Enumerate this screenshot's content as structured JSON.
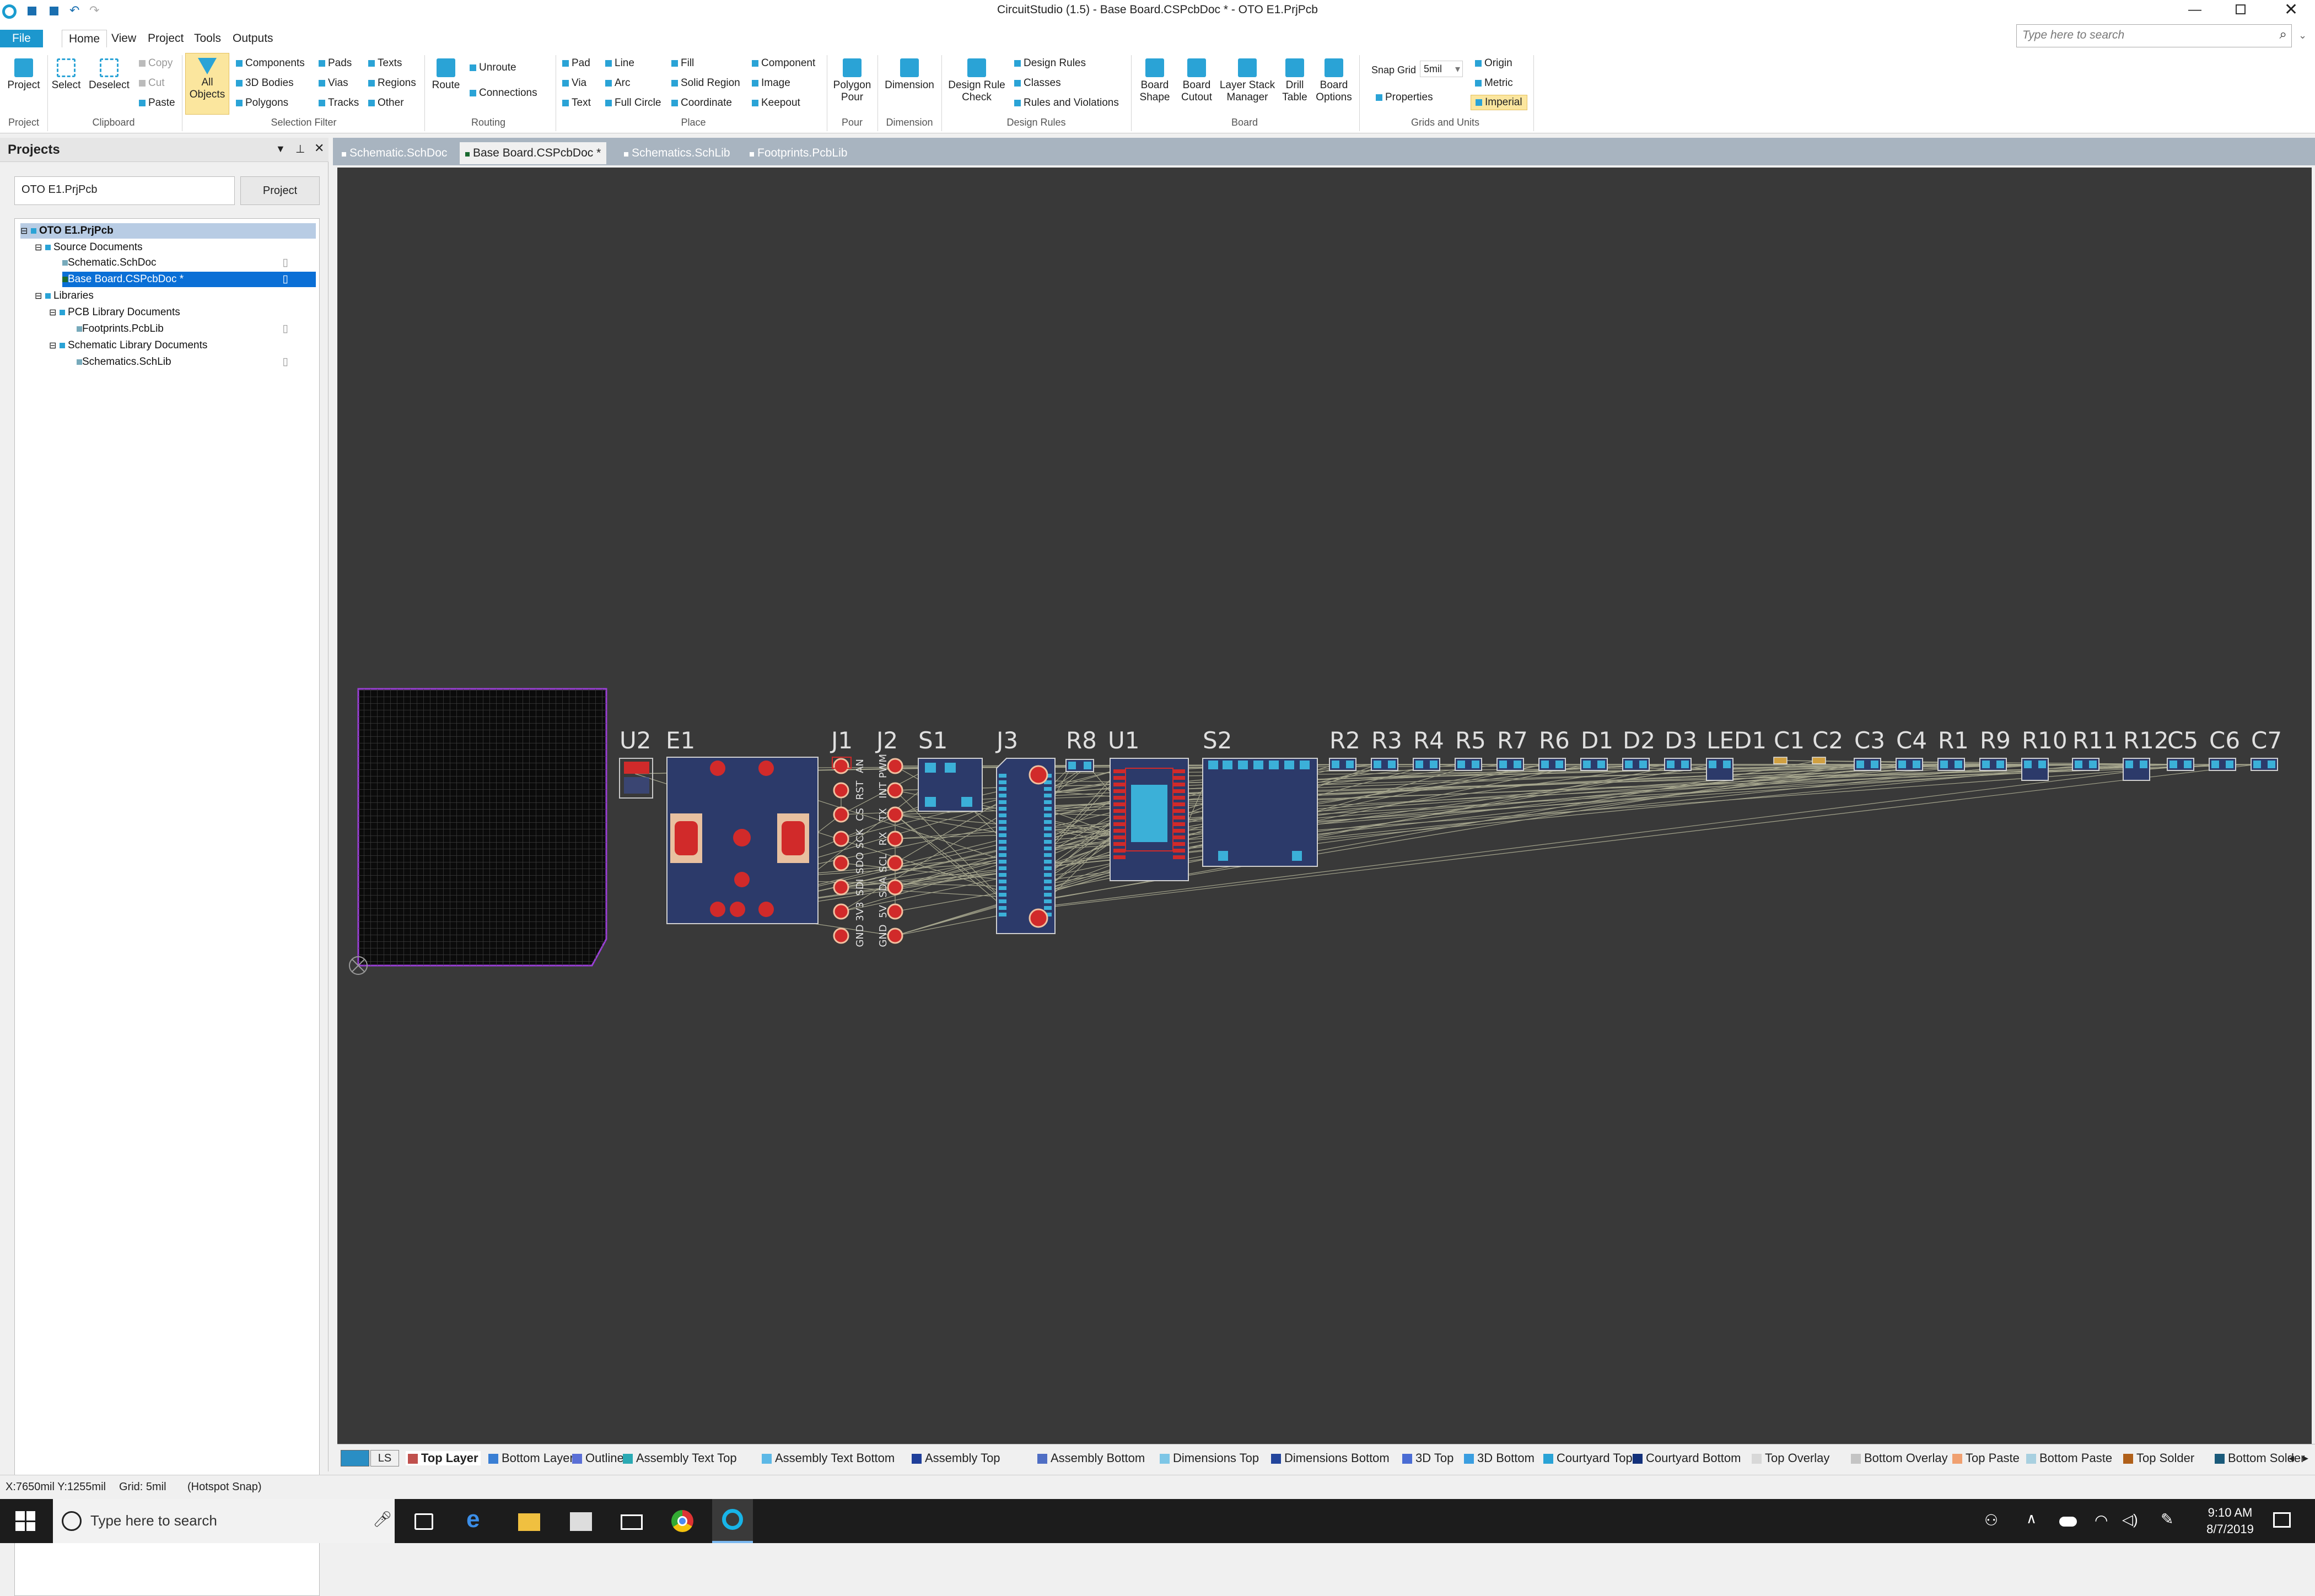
{
  "window": {
    "title": "CircuitStudio (1.5) - Base Board.CSPcbDoc * - OTO E1.PrjPcb",
    "search_placeholder": "Type here to search"
  },
  "menu": {
    "file": "File",
    "items": [
      "Home",
      "View",
      "Project",
      "Tools",
      "Outputs"
    ]
  },
  "ribbon": {
    "project": {
      "btn": "Project",
      "label": "Project"
    },
    "clipboard": {
      "select": "Select",
      "deselect": "Deselect",
      "copy": "Copy",
      "cut": "Cut",
      "paste": "Paste",
      "label": "Clipboard"
    },
    "selection": {
      "all_objects": [
        "All",
        "Objects"
      ],
      "components": "Components",
      "bodies": "3D Bodies",
      "polygons": "Polygons",
      "pads": "Pads",
      "vias": "Vias",
      "tracks": "Tracks",
      "texts": "Texts",
      "regions": "Regions",
      "other": "Other",
      "label": "Selection Filter"
    },
    "routing": {
      "route": "Route",
      "unroute": "Unroute",
      "connections": "Connections",
      "label": "Routing"
    },
    "place": {
      "pad": "Pad",
      "via": "Via",
      "text": "Text",
      "line": "Line",
      "arc": "Arc",
      "full_circle": "Full Circle",
      "fill": "Fill",
      "solid_region": "Solid Region",
      "coordinate": "Coordinate",
      "component": "Component",
      "image": "Image",
      "keepout": "Keepout",
      "label": "Place"
    },
    "pour": {
      "polygon": [
        "Polygon",
        "Pour"
      ],
      "label": "Pour"
    },
    "dimension": {
      "btn": "Dimension",
      "label": "Dimension"
    },
    "design_rules": {
      "check": [
        "Design Rule",
        "Check"
      ],
      "rules": "Design Rules",
      "classes": "Classes",
      "violations": "Rules and Violations",
      "label": "Design Rules"
    },
    "board": {
      "shape": [
        "Board",
        "Shape"
      ],
      "cutout": [
        "Board",
        "Cutout"
      ],
      "stack": [
        "Layer Stack",
        "Manager"
      ],
      "drill": [
        "Drill",
        "Table"
      ],
      "options": [
        "Board",
        "Options"
      ],
      "label": "Board"
    },
    "grids": {
      "snap_label": "Snap Grid",
      "snap_value": "5mil",
      "properties": "Properties",
      "origin": "Origin",
      "metric": "Metric",
      "imperial": "Imperial",
      "label": "Grids and Units"
    }
  },
  "panel": {
    "title": "Projects",
    "project_field": "OTO E1.PrjPcb",
    "project_btn": "Project",
    "tree": [
      "OTO E1.PrjPcb",
      "Source Documents",
      "Schematic.SchDoc",
      "Base Board.CSPcbDoc *",
      "Libraries",
      "PCB Library Documents",
      "Footprints.PcbLib",
      "Schematic Library Documents",
      "Schematics.SchLib"
    ]
  },
  "doctabs": [
    "Schematic.SchDoc",
    "Base Board.CSPcbDoc *",
    "Schematics.SchLib",
    "Footprints.PcbLib"
  ],
  "pcb": {
    "designators": [
      "U2",
      "E1",
      "J1",
      "J2",
      "S1",
      "J3",
      "R8",
      "U1",
      "S2",
      "R2",
      "R3",
      "R4",
      "R5",
      "R7",
      "R6",
      "D1",
      "D2",
      "D3",
      "LED1",
      "C1",
      "C2",
      "C3",
      "C4",
      "R1",
      "R9",
      "R10",
      "R11",
      "R12",
      "C5",
      "C6",
      "C7"
    ],
    "j1_pins": [
      "AN",
      "RST",
      "CS",
      "SCK",
      "SDO",
      "SDI",
      "3V3",
      "GND"
    ],
    "j2_pins": [
      "PWM",
      "INT",
      "TX",
      "RX",
      "SCL",
      "SDA",
      "5V",
      "GND"
    ]
  },
  "layers": {
    "ls": "LS",
    "items": [
      {
        "name": "Top Layer",
        "color": "#c0504d"
      },
      {
        "name": "Bottom Layer",
        "color": "#3a7fd4"
      },
      {
        "name": "Outline",
        "color": "#5a6fd6"
      },
      {
        "name": "Assembly Text Top",
        "color": "#2aa9b3"
      },
      {
        "name": "Assembly Text Bottom",
        "color": "#5cb8e6"
      },
      {
        "name": "Assembly Top",
        "color": "#1f3f9a"
      },
      {
        "name": "Assembly Bottom",
        "color": "#4f6ec4"
      },
      {
        "name": "Dimensions Top",
        "color": "#7dc6e6"
      },
      {
        "name": "Dimensions Bottom",
        "color": "#23459c"
      },
      {
        "name": "3D Top",
        "color": "#4a6cd4"
      },
      {
        "name": "3D Bottom",
        "color": "#3a9ee0"
      },
      {
        "name": "Courtyard Top",
        "color": "#2aa3d6"
      },
      {
        "name": "Courtyard Bottom",
        "color": "#12307a"
      },
      {
        "name": "Top Overlay",
        "color": "#d8d8d8"
      },
      {
        "name": "Bottom Overlay",
        "color": "#c4c4c4"
      },
      {
        "name": "Top Paste",
        "color": "#f0a070"
      },
      {
        "name": "Bottom Paste",
        "color": "#a8d0e0"
      },
      {
        "name": "Top Solder",
        "color": "#b0601a"
      },
      {
        "name": "Bottom Solder",
        "color": "#1a5a7a"
      }
    ]
  },
  "status": {
    "coords": "X:7650mil Y:1255mil",
    "grid": "Grid: 5mil",
    "snap": "(Hotspot Snap)"
  },
  "taskbar": {
    "search": "Type here to search",
    "time": "9:10 AM",
    "date": "8/7/2019"
  }
}
